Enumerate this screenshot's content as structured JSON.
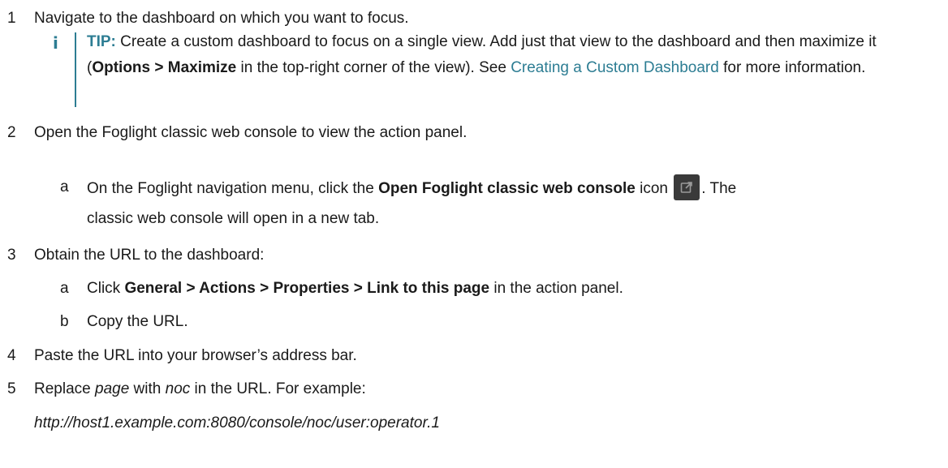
{
  "steps": [
    {
      "num": "1",
      "text": "Navigate to the dashboard on which you want to focus."
    },
    {
      "num": "2",
      "text": "Open the Foglight classic web console to view the action panel."
    },
    {
      "num": "3",
      "text": "Obtain the URL to the dashboard:"
    },
    {
      "num": "4",
      "text": "Paste the URL into your browser’s address bar."
    },
    {
      "num": "5",
      "pre": "Replace ",
      "em1": "page",
      "mid": " with ",
      "em2": "noc",
      "post": " in the URL. For example:"
    }
  ],
  "tip": {
    "label": "TIP:",
    "text1": " Create a custom dashboard to focus on a single view. Add just that view to the dashboard and then maximize it (",
    "bold": "Options > Maximize",
    "text2": " in the top-right corner of the view). See ",
    "link": "Creating a Custom Dashboard",
    "text3": " for more information.",
    "icon": "info-icon"
  },
  "substep2a": {
    "letter": "a",
    "pre": "On the Foglight navigation menu, click the ",
    "bold": "Open Foglight classic web console",
    "mid": " icon ",
    "post": ". The",
    "line2": "classic web console will open in a new tab.",
    "icon": "external-link-icon"
  },
  "substep3a": {
    "letter": "a",
    "pre": "Click ",
    "bold": "General > Actions > Properties > Link to this page",
    "post": " in the action panel."
  },
  "substep3b": {
    "letter": "b",
    "text": "Copy the URL."
  },
  "example_url": "http://host1.example.com:8080/console/noc/user:operator.1"
}
